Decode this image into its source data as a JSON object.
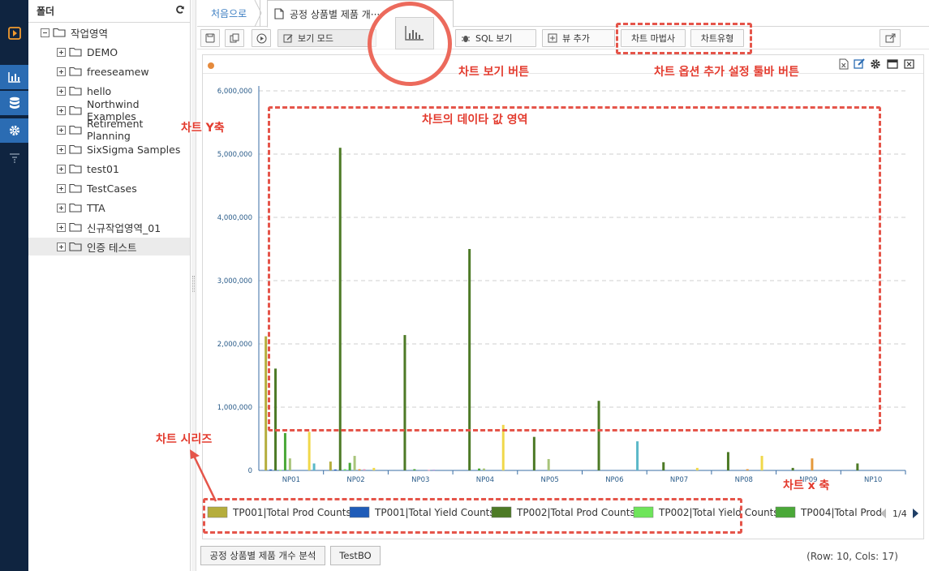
{
  "folder": {
    "title": "폴더",
    "root": "작업영역",
    "items": [
      "DEMO",
      "freeseamew",
      "hello",
      "Northwind Examples",
      "Retirement Planning",
      "SixSigma Samples",
      "test01",
      "TestCases",
      "TTA",
      "신규작업영역_01",
      "인증 테스트"
    ]
  },
  "tabs": {
    "home": "처음으로",
    "active": "공정 상품별 제품 개···"
  },
  "toolbar": {
    "view_mode": "보기 모드",
    "sql_view": "SQL 보기",
    "add_view": "뷰 추가",
    "chart_wizard": "차트 마법사",
    "chart_type": "차트유형"
  },
  "colors": {
    "accent": "#2b6cb3",
    "annotation": "#e5554a"
  },
  "chart_data": {
    "type": "bar",
    "categories": [
      "NP01",
      "NP02",
      "NP03",
      "NP04",
      "NP05",
      "NP06",
      "NP07",
      "NP08",
      "NP09",
      "NP10"
    ],
    "ylim": [
      0,
      6000000
    ],
    "yticks": [
      "0",
      "1,000,000",
      "2,000,000",
      "3,000,000",
      "4,000,000",
      "5,000,000",
      "6,000,000"
    ],
    "series": [
      {
        "name": "TP001|Total Prod Counts",
        "color": "#b5ad3c",
        "values": [
          2120000,
          140000,
          0,
          0,
          0,
          0,
          0,
          0,
          0,
          0
        ]
      },
      {
        "name": "TP001|Total Yield Counts",
        "color": "#1f5cb8",
        "values": [
          15000,
          15000,
          0,
          0,
          0,
          0,
          0,
          0,
          0,
          0
        ]
      },
      {
        "name": "TP002|Total Prod Counts",
        "color": "#4d7a26",
        "values": [
          1610000,
          5100000,
          2140000,
          3500000,
          530000,
          1100000,
          130000,
          290000,
          40000,
          110000
        ]
      },
      {
        "name": "TP002|Total Yield Counts",
        "color": "#6ee55a",
        "values": [
          10000,
          20000,
          0,
          0,
          0,
          0,
          0,
          0,
          0,
          0
        ]
      },
      {
        "name": "TP004|Total Prod",
        "color": "#4aa838",
        "values": [
          590000,
          120000,
          20000,
          30000,
          0,
          0,
          0,
          0,
          0,
          0
        ]
      },
      {
        "name": "",
        "color": "#a8c47a",
        "values": [
          190000,
          230000,
          0,
          30000,
          180000,
          0,
          0,
          0,
          0,
          0
        ]
      },
      {
        "name": "",
        "color": "#e59a3c",
        "values": [
          0,
          20000,
          0,
          0,
          0,
          0,
          0,
          20000,
          190000,
          0
        ]
      },
      {
        "name": "",
        "color": "#e89ab8",
        "values": [
          0,
          20000,
          10000,
          0,
          0,
          0,
          0,
          0,
          0,
          0
        ]
      },
      {
        "name": "",
        "color": "#9a7ac8",
        "values": [
          0,
          0,
          10000,
          0,
          0,
          0,
          0,
          0,
          0,
          0
        ]
      },
      {
        "name": "",
        "color": "#f0d84a",
        "values": [
          610000,
          40000,
          0,
          720000,
          0,
          0,
          40000,
          230000,
          0,
          0
        ]
      },
      {
        "name": "",
        "color": "#5bb8c8",
        "values": [
          110000,
          0,
          0,
          0,
          0,
          460000,
          0,
          0,
          0,
          0
        ]
      }
    ],
    "legend_page": "1/4",
    "legend_position": "bottom"
  },
  "bottom": {
    "tab1": "공정 상품별 제품 개수 분석",
    "tab2": "TestBO",
    "status": "(Row: 10, Cols: 17)"
  },
  "annotations": {
    "chart_view_button": "차트 보기 버튼",
    "chart_option_toolbar": "차트 옵션 추가 설정 툴바 버튼",
    "y_axis": "차트 Y축",
    "data_area": "차트의 데이타 값 영역",
    "series": "차트 시리즈",
    "x_axis": "차트 x 축"
  }
}
